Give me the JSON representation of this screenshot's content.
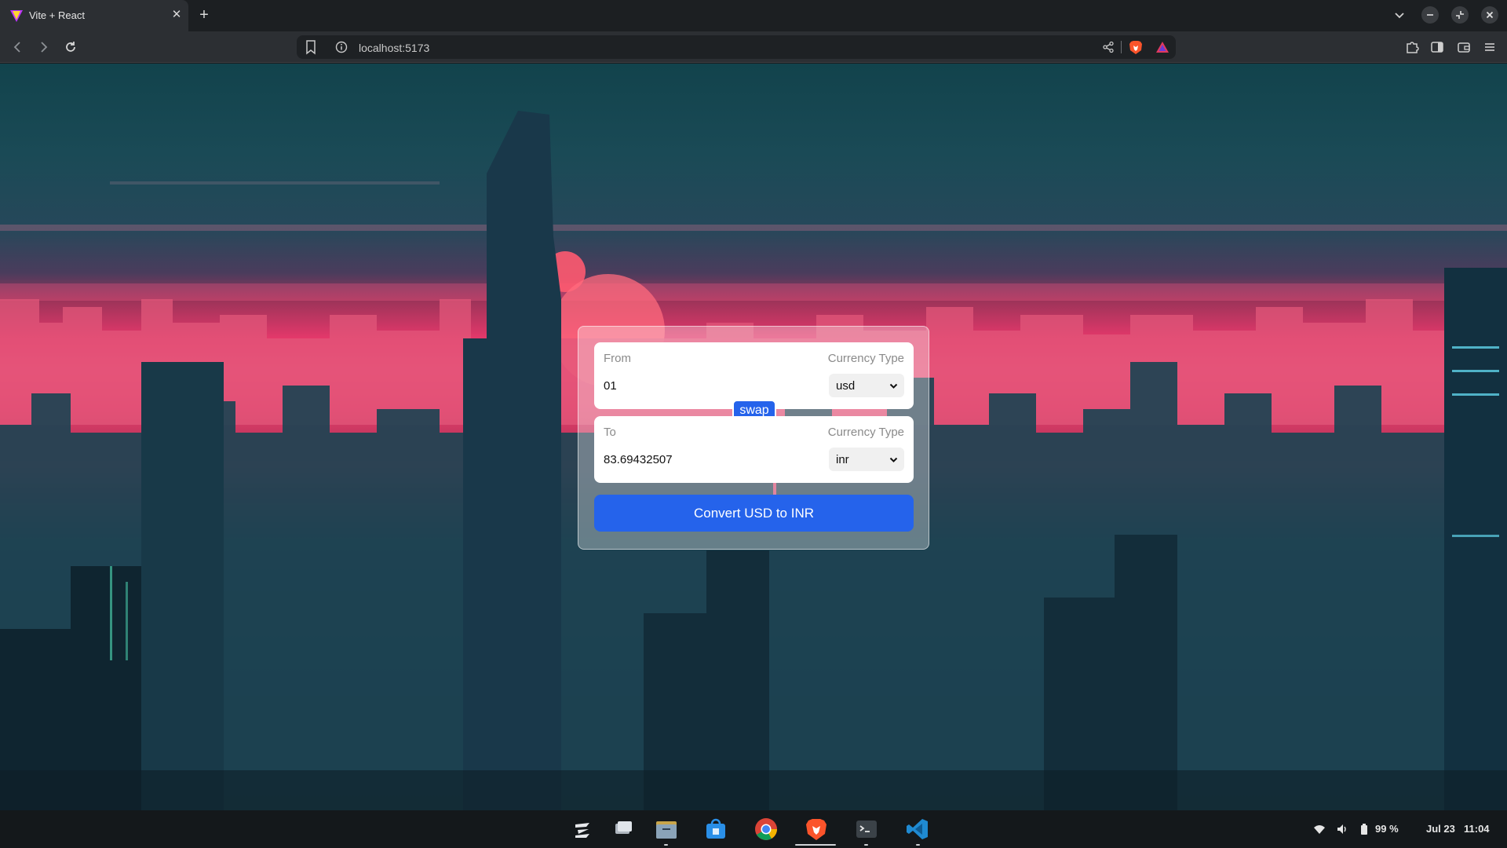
{
  "browser": {
    "tab_title": "Vite + React",
    "url": "localhost:5173"
  },
  "converter": {
    "from": {
      "label": "From",
      "currency_type_label": "Currency Type",
      "amount": "01",
      "currency": "usd"
    },
    "to": {
      "label": "To",
      "currency_type_label": "Currency Type",
      "amount": "83.69432507",
      "currency": "inr"
    },
    "swap_label": "swap",
    "convert_label": "Convert USD to INR",
    "accent_color": "#2563eb"
  },
  "taskbar": {
    "apps": [
      "zorin-menu-icon",
      "workspaces-icon",
      "files-icon",
      "software-store-icon",
      "chrome-icon",
      "brave-icon",
      "terminal-icon",
      "vscode-icon"
    ],
    "battery": "99 %",
    "date": "Jul 23",
    "time": "11:04"
  }
}
